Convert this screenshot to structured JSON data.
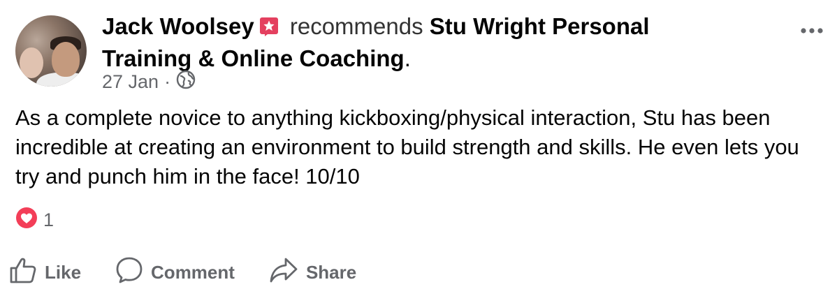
{
  "post": {
    "author": "Jack Woolsey",
    "action_text": "recommends",
    "page_name": "Stu Wright Personal Training & Online Coaching",
    "period": ".",
    "date": "27 Jan",
    "separator": "·",
    "body": "As a complete novice to anything kickboxing/physical interaction, Stu has been incredible at creating an environment to build strength and skills. He even lets you try and punch him in the face! 10/10",
    "reaction_count": "1"
  },
  "actions": {
    "like_label": "Like",
    "comment_label": "Comment",
    "share_label": "Share"
  },
  "icons": {
    "badge": "recommendation-star-icon",
    "privacy": "globe-icon",
    "more": "more-dots-icon",
    "reaction": "love-reaction-icon",
    "like": "thumbs-up-icon",
    "comment": "comment-bubble-icon",
    "share": "share-arrow-icon"
  },
  "colors": {
    "badge": "#e4405f",
    "reaction": "#f33e58",
    "muted_text": "#65676b",
    "text": "#050505"
  }
}
